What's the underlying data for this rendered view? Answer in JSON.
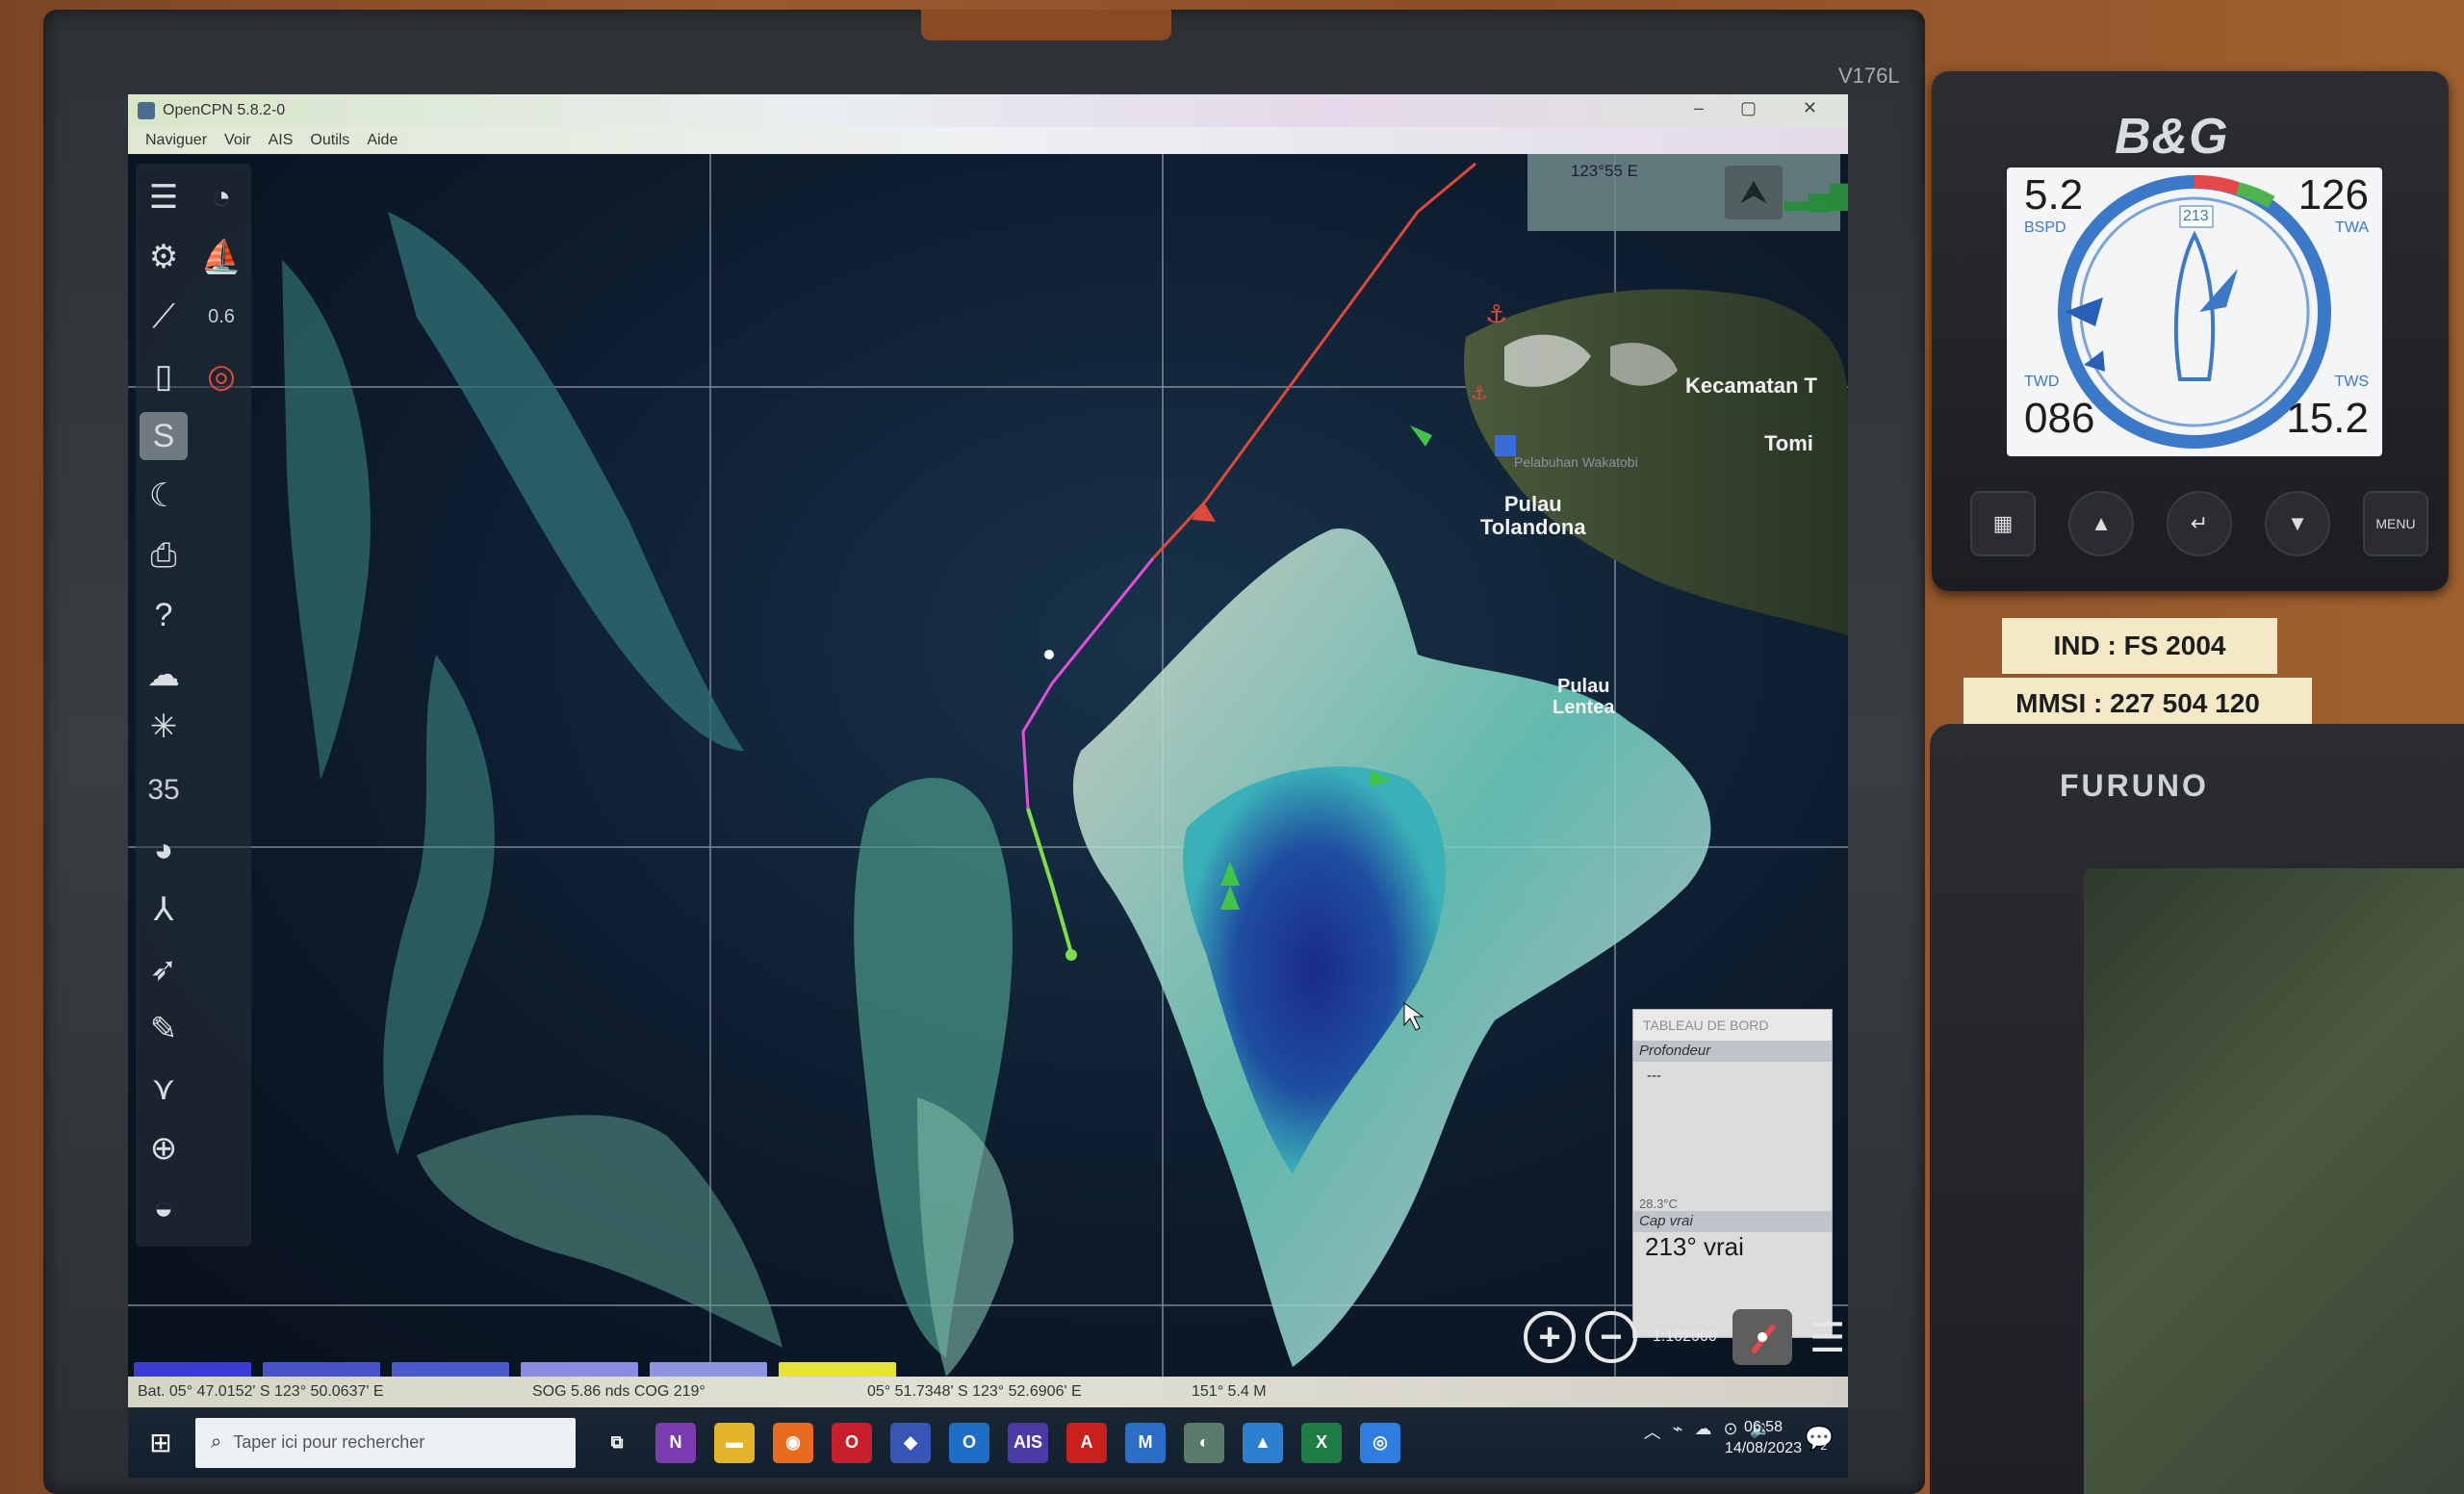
{
  "monitor": {
    "model": "V176L"
  },
  "window": {
    "title": "OpenCPN 5.8.2-0",
    "controls": {
      "minimize": "–",
      "maximize": "▢",
      "close": "✕"
    }
  },
  "menu": {
    "items": [
      "Naviguer",
      "Voir",
      "AIS",
      "Outils",
      "Aide"
    ]
  },
  "toolbar": {
    "speed_badge": "0.6",
    "layers_badge": "35"
  },
  "chart": {
    "lon_label": "123°55 E",
    "places": {
      "kecamatan": "Kecamatan T",
      "tomi": "Tomi",
      "tolandona": "Pulau\nTolandona",
      "lentea": "Pulau\nLentea",
      "harbor": "Pelabuhan Wakatobi"
    },
    "scale": "1:102000"
  },
  "dashboard": {
    "title": "TABLEAU DE BORD",
    "depth_label": "Profondeur",
    "depth_value": "---",
    "temperature": "28.3°C",
    "heading_label": "Cap vrai",
    "heading_value": "213° vrai"
  },
  "chart_bar_colors": [
    "#3b3bd0",
    "#4a52c8",
    "#4a5acb",
    "#8a8ce0",
    "#8e95de",
    "#e6e23a"
  ],
  "status": {
    "boat_pos": "Bat. 05° 47.0152' S   123° 50.0637' E",
    "sog_cog": "SOG 5.86 nds   COG 219°",
    "cursor_pos": "05° 51.7348' S   123° 52.6906' E",
    "bearing_dist": "151°   5.4 M"
  },
  "taskbar": {
    "search_placeholder": "Taper ici pour rechercher",
    "time": "06:58",
    "date": "14/08/2023",
    "notif_count": "2",
    "app_icons": [
      {
        "name": "task-view",
        "label": "⧉",
        "bg": "transparent"
      },
      {
        "name": "onenote",
        "label": "N",
        "bg": "#7b3cb0"
      },
      {
        "name": "file-explorer",
        "label": "▬",
        "bg": "#e3b42a"
      },
      {
        "name": "firefox",
        "label": "◉",
        "bg": "#e86b1f"
      },
      {
        "name": "opera",
        "label": "O",
        "bg": "#c8202a"
      },
      {
        "name": "shield-app",
        "label": "◆",
        "bg": "#3655b5"
      },
      {
        "name": "outlook",
        "label": "O",
        "bg": "#1d6ec4"
      },
      {
        "name": "pro-ais",
        "label": "AIS",
        "bg": "#4b3aa6"
      },
      {
        "name": "acrobat",
        "label": "A",
        "bg": "#c9201f"
      },
      {
        "name": "m-app",
        "label": "M",
        "bg": "#2a6ec8"
      },
      {
        "name": "opencpn",
        "label": "◐",
        "bg": "#5a7a6a"
      },
      {
        "name": "photos",
        "label": "▲",
        "bg": "#2d7fd0"
      },
      {
        "name": "excel",
        "label": "X",
        "bg": "#1e7d45"
      },
      {
        "name": "chrome-like",
        "label": "◎",
        "bg": "#2e7de0"
      }
    ]
  },
  "bg_instrument": {
    "brand": "B&G",
    "bspd_value": "5.2",
    "bspd_label": "BSPD",
    "twa_value": "126",
    "twa_label": "TWA",
    "twd_value": "086",
    "twd_label": "TWD",
    "tws_value": "15.2",
    "tws_label": "TWS",
    "heading": "213",
    "menu_label": "MENU"
  },
  "plates": {
    "ind": "IND  :  FS 2004",
    "mmsi": "MMSI  :  227 504 120"
  },
  "furuno": {
    "brand": "FURUNO"
  }
}
